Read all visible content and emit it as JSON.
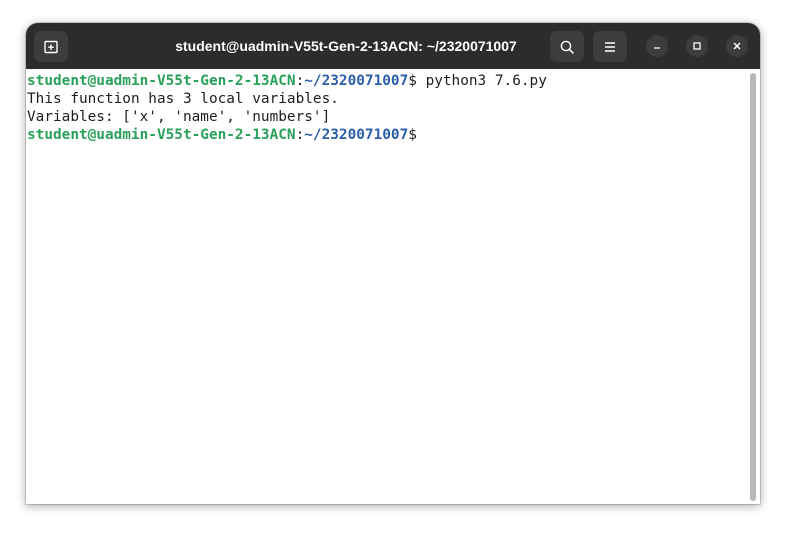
{
  "window": {
    "title": "student@uadmin-V55t-Gen-2-13ACN: ~/2320071007"
  },
  "icons": {
    "new_tab": "new-tab-icon",
    "search": "search-icon",
    "menu": "hamburger-menu-icon",
    "minimize": "minimize-icon",
    "maximize": "maximize-icon",
    "close": "close-icon"
  },
  "colors": {
    "titlebar": "#2c2c2c",
    "prompt_user": "#2aa15a",
    "prompt_path": "#2a5ea8",
    "terminal_bg": "#ffffff",
    "text": "#1e1e1e"
  },
  "terminal": {
    "prompt1": {
      "user": "student@uadmin-V55t-Gen-2-13ACN",
      "colon": ":",
      "path": "~/2320071007",
      "dollar": "$",
      "command": " python3 7.6.py"
    },
    "output": [
      "This function has 3 local variables.",
      "Variables: ['x', 'name', 'numbers']"
    ],
    "prompt2": {
      "user": "student@uadmin-V55t-Gen-2-13ACN",
      "colon": ":",
      "path": "~/2320071007",
      "dollar": "$"
    }
  }
}
